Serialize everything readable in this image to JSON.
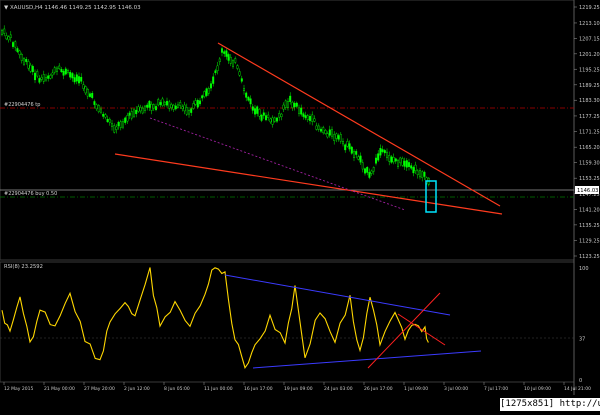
{
  "header": {
    "symbol_line": "▼ XAUUSD,H4  1146.46  1149.25  1142.95  1146.03"
  },
  "colors": {
    "background": "#000000",
    "candle": "#00ff00",
    "trend_red": "#ff3b1e",
    "dash_red": "#b40000",
    "dash_purple": "#a020a0",
    "rsi": "#ffd700",
    "rsi_channel": "#3b3bff",
    "highlight_box": "#00e5ff",
    "grid": "#2a2a2a",
    "price_tag_bg": "#ffffff"
  },
  "price_panel": {
    "resistance_label": "#22904476 tp",
    "position_label": "#22904476 buy 0.50",
    "current_price": "1146.03",
    "ticks": [
      {
        "label": "1219.25",
        "value": 1219.25
      },
      {
        "label": "1213.10",
        "value": 1213.1
      },
      {
        "label": "1207.15",
        "value": 1207.15
      },
      {
        "label": "1201.20",
        "value": 1201.2
      },
      {
        "label": "1195.25",
        "value": 1195.25
      },
      {
        "label": "1189.25",
        "value": 1189.25
      },
      {
        "label": "1183.30",
        "value": 1183.3
      },
      {
        "label": "1177.25",
        "value": 1177.25
      },
      {
        "label": "1171.25",
        "value": 1171.25
      },
      {
        "label": "1165.20",
        "value": 1165.2
      },
      {
        "label": "1159.30",
        "value": 1159.3
      },
      {
        "label": "1153.25",
        "value": 1153.25
      },
      {
        "label": "1147.25",
        "value": 1147.25
      },
      {
        "label": "1141.20",
        "value": 1141.2
      },
      {
        "label": "1135.25",
        "value": 1135.25
      },
      {
        "label": "1129.25",
        "value": 1129.25
      },
      {
        "label": "1123.25",
        "value": 1123.25
      }
    ]
  },
  "rsi_panel": {
    "label": "RSI(8) 23.2592",
    "ticks": [
      {
        "label": "100",
        "value": 100
      },
      {
        "label": "37",
        "value": 37
      },
      {
        "label": "0",
        "value": 0
      }
    ]
  },
  "time_axis": [
    "12 May 2015",
    "21 May 00:00",
    "27 May 20:00",
    "2 Jun 12:00",
    "8 Jun 05:00",
    "11 Jun 00:00",
    "16 Jun 17:00",
    "19 Jun 09:00",
    "24 Jun 03:00",
    "26 Jun 17:00",
    "1 Jul 09:00",
    "3 Jul 00:00",
    "7 Jul 17:00",
    "10 Jul 09:00",
    "14 Jul 21:00"
  ],
  "footer": {
    "tag": "[1275x851] http://upic.me/"
  }
}
